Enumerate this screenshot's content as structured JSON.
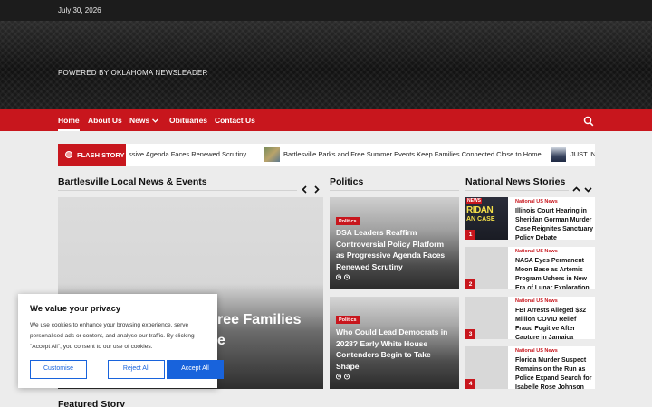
{
  "topbar": {
    "date": "July 30, 2026"
  },
  "hero": {
    "tagline": "POWERED BY OKLAHOMA NEWSLEADER"
  },
  "nav": {
    "items": [
      "Home",
      "About Us",
      "News",
      "Obituaries",
      "Contact Us"
    ],
    "search_icon": "search-icon",
    "dropdown_icon": "chevron-down-icon"
  },
  "flash": {
    "label": "FLASH STORY",
    "ticker": [
      "ssive Agenda Faces Renewed Scrutiny",
      "Bartlesville Parks and Free Summer Events Keep Families Connected Close to Home",
      "JUST IN"
    ]
  },
  "sections": {
    "local": "Bartlesville Local News & Events",
    "politics": "Politics",
    "national": "National News Stories",
    "featured": "Featured Story"
  },
  "main_feature": {
    "headline": "d Free Families ome"
  },
  "politics_cards": [
    {
      "badge": "Politics",
      "title": "DSA Leaders Reaffirm Controversial Policy Platform as Progressive Agenda Faces Renewed Scrutiny"
    },
    {
      "badge": "Politics",
      "title": "Who Could Lead Democrats in 2028? Early White House Contenders Begin to Take Shape"
    }
  ],
  "national": [
    {
      "num": "1",
      "cat": "National US News",
      "title": "Illinois Court Hearing in Sheridan Gorman Murder Case Reignites Sanctuary Policy Debate"
    },
    {
      "num": "2",
      "cat": "National US News",
      "title": "NASA Eyes Permanent Moon Base as Artemis Program Ushers in New Era of Lunar Exploration"
    },
    {
      "num": "3",
      "cat": "National US News",
      "title": "FBI Arrests Alleged $32 Million COVID Relief Fraud Fugitive After Capture in Jamaica"
    },
    {
      "num": "4",
      "cat": "National US News",
      "title": "Florida Murder Suspect Remains on the Run as Police Expand Search for Isabelle Rose Johnson"
    }
  ],
  "thumb_text": {
    "line1": "NEWS",
    "line2": "RIDAN",
    "line3": "AN CASE"
  },
  "cookie": {
    "title": "We value your privacy",
    "body": "We use cookies to enhance your browsing experience, serve personalised ads or content, and analyse our traffic. By clicking \"Accept All\", you consent to our use of cookies.",
    "customise": "Customise",
    "reject": "Reject All",
    "accept": "Accept All"
  },
  "colors": {
    "brand_red": "#c8161d",
    "topbar": "#1c1c1c",
    "cookie_blue": "#1863dc"
  }
}
